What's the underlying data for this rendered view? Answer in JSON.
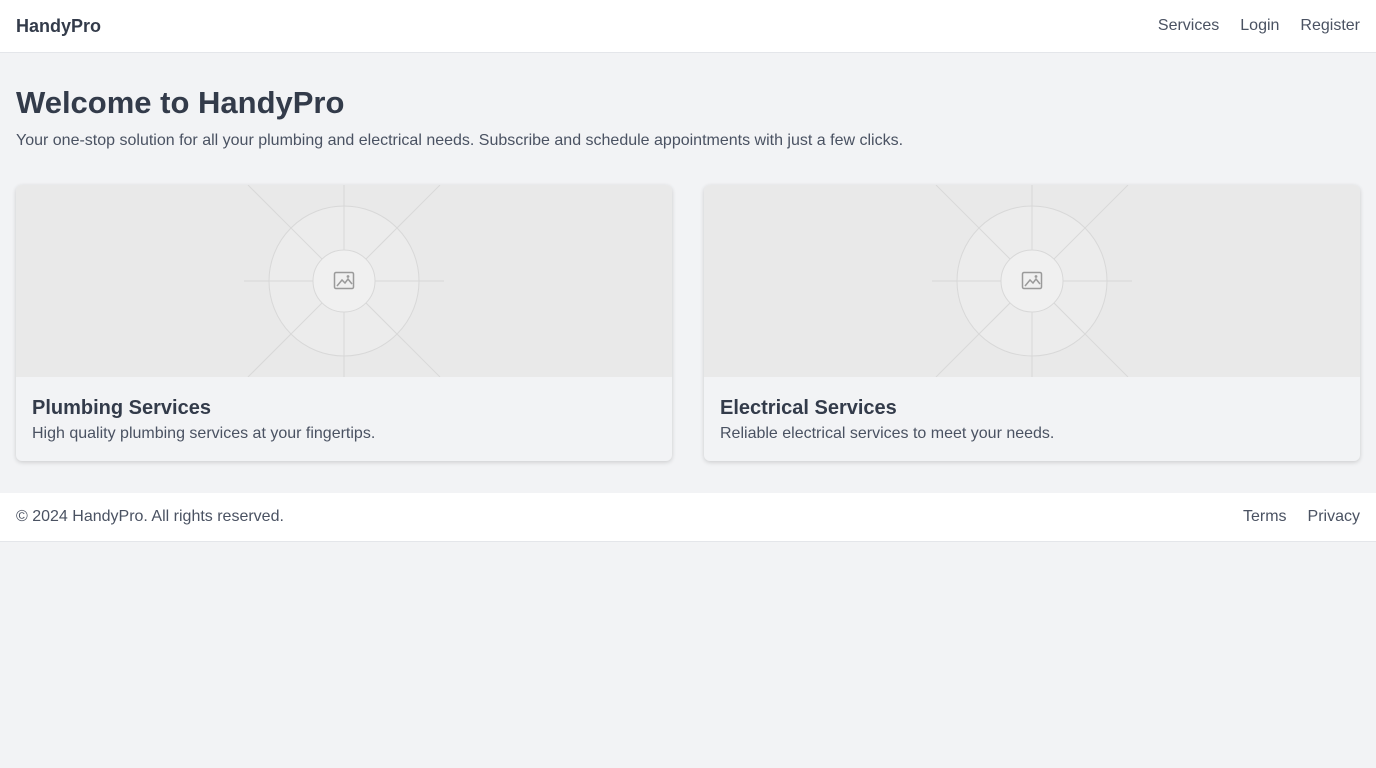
{
  "header": {
    "brand": "HandyPro",
    "nav": [
      {
        "label": "Services"
      },
      {
        "label": "Login"
      },
      {
        "label": "Register"
      }
    ]
  },
  "hero": {
    "title": "Welcome to HandyPro",
    "subtitle": "Your one-stop solution for all your plumbing and electrical needs. Subscribe and schedule appointments with just a few clicks."
  },
  "cards": [
    {
      "image_icon": "image-placeholder-icon",
      "title": "Plumbing Services",
      "description": "High quality plumbing services at your fingertips."
    },
    {
      "image_icon": "image-placeholder-icon",
      "title": "Electrical Services",
      "description": "Reliable electrical services to meet your needs."
    }
  ],
  "footer": {
    "copyright": "© 2024 HandyPro. All rights reserved.",
    "links": [
      {
        "label": "Terms"
      },
      {
        "label": "Privacy"
      }
    ]
  },
  "colors": {
    "page_background": "#f2f3f5",
    "surface": "#ffffff",
    "text_primary": "#333b4a",
    "text_secondary": "#4a5262",
    "placeholder_background": "#e9e9e9"
  }
}
